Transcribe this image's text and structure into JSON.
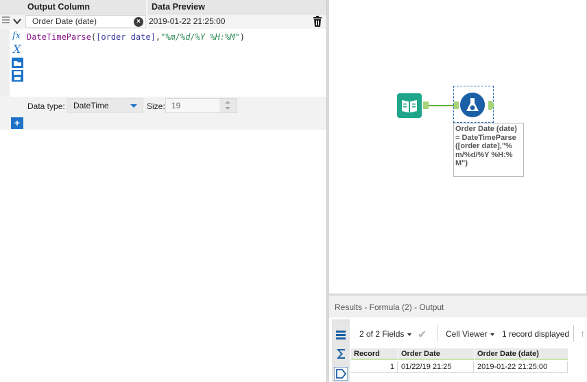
{
  "config": {
    "headers": {
      "output_column": "Output Column",
      "data_preview": "Data Preview"
    },
    "row": {
      "name": "Order Date (date)",
      "preview": "2019-01-22 21:25:00",
      "expression": {
        "fn": "DateTimeParse",
        "open": "(",
        "field": "[order date]",
        "comma": ",",
        "format": "\"%m/%d/%Y %H:%M\"",
        "close": ")"
      }
    },
    "data_type_label": "Data type:",
    "data_type_value": "DateTime",
    "size_label": "Size:",
    "size_value": "19",
    "tool_icons": [
      "function-icon",
      "variable-icon",
      "open-icon",
      "save-icon"
    ]
  },
  "canvas": {
    "annotation": "Order Date (date)\n= DateTimeParse\n([order date],\"%\nm/%d/%Y %H:%\nM\")"
  },
  "results": {
    "title": "Results - Formula (2) - Output",
    "fields_selector": "2 of 2 Fields",
    "viewer": "Cell Viewer",
    "record_count": "1 record displayed",
    "columns": [
      "Record",
      "Order Date",
      "Order Date (date)"
    ],
    "rows": [
      {
        "record": "1",
        "order_date": "01/22/19 21:25",
        "order_date_date": "2019-01-22 21:25:00"
      }
    ]
  },
  "colors": {
    "accent_blue": "#1e73c9",
    "input_tool_teal": "#1fa68a",
    "formula_tool_blue": "#1b5fa6",
    "connection_green": "#5fb23d"
  }
}
